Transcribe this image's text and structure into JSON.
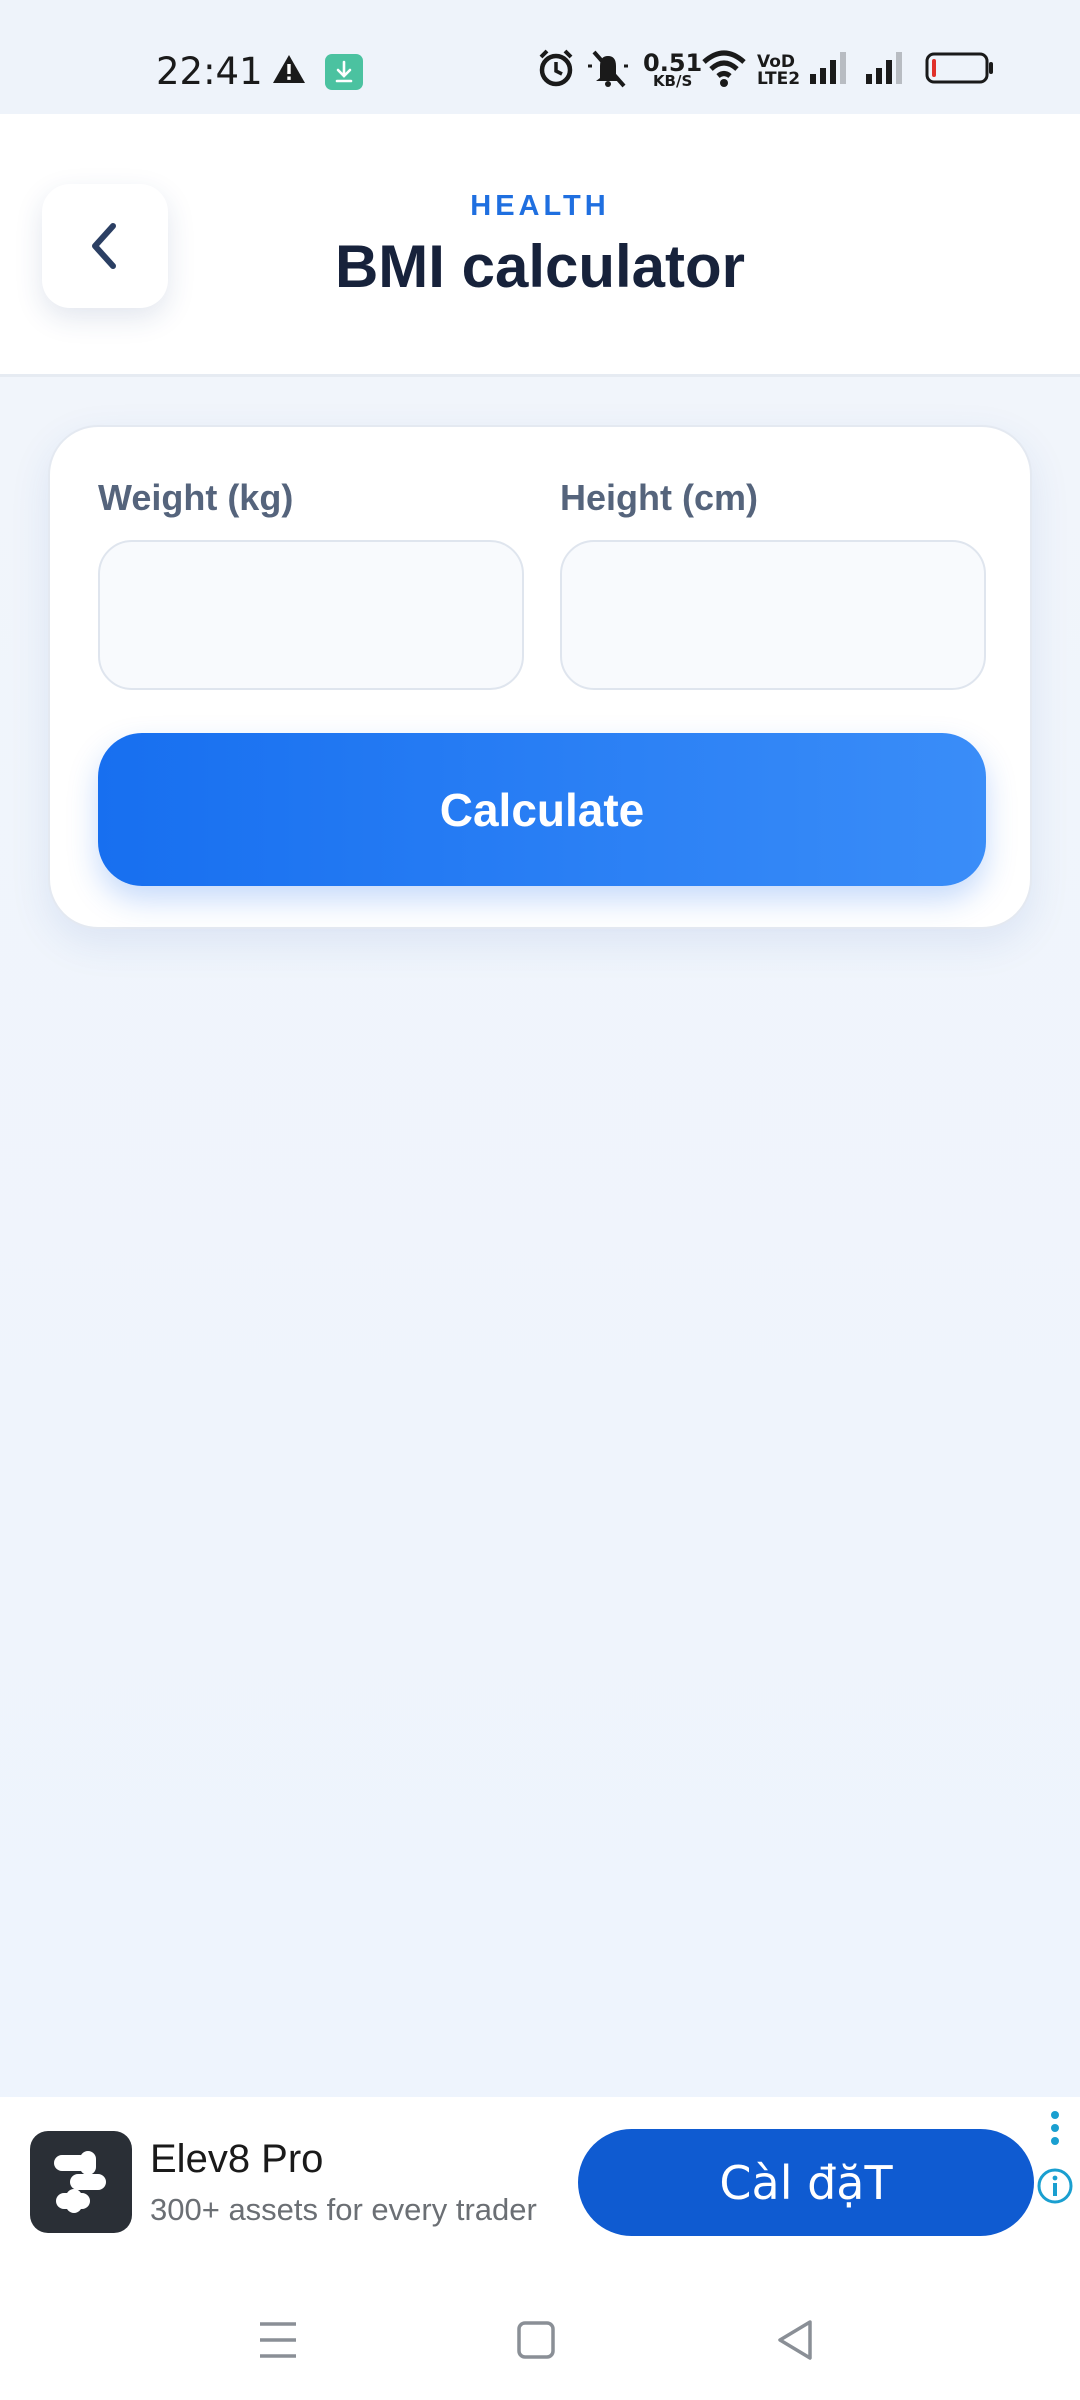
{
  "status_bar": {
    "time": "22:41",
    "speed_value": "0.51",
    "speed_unit": "KB/S",
    "volte_top": "VoD",
    "volte_bottom": "LTE2",
    "icons": [
      "warning-icon",
      "download-icon",
      "alarm-icon",
      "mute-icon",
      "wifi-icon",
      "signal-icon",
      "signal-icon",
      "battery-icon"
    ],
    "battery_color": "#e0302a"
  },
  "header": {
    "eyebrow": "HEALTH",
    "title": "BMI calculator",
    "back_icon": "chevron-left-icon"
  },
  "form": {
    "weight_label": "Weight (kg)",
    "weight_value": "",
    "height_label": "Height (cm)",
    "height_value": "",
    "calculate_label": "Calculate",
    "accent_color": "#1f6fe0"
  },
  "ad": {
    "app_name": "Elev8 Pro",
    "tagline": "300+ assets for every trader",
    "cta": "Càl đặT",
    "cta_color": "#0f5bd1"
  },
  "nav_bar": {
    "items": [
      "menu-icon",
      "home-icon",
      "back-icon"
    ]
  }
}
